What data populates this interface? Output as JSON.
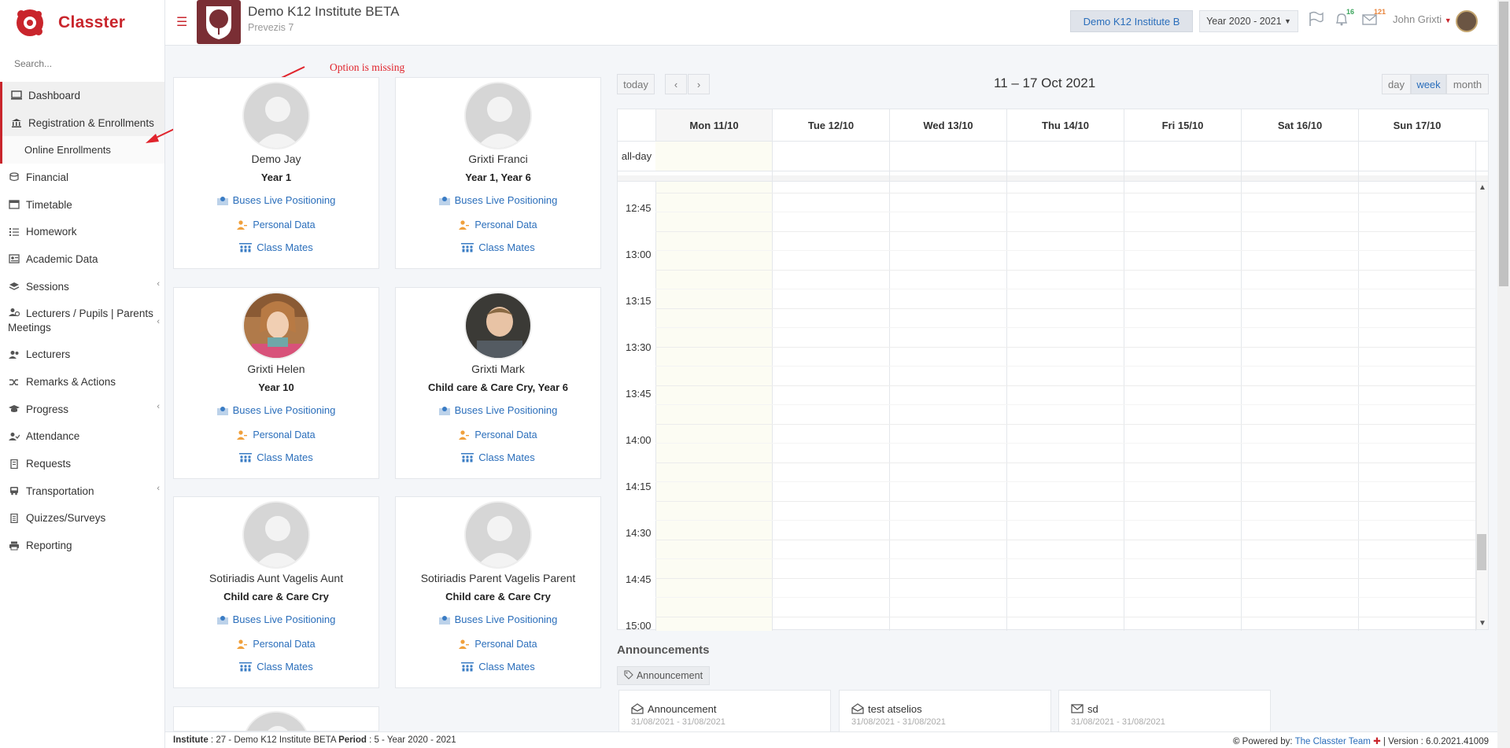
{
  "app": {
    "brand": "Classter"
  },
  "search": {
    "placeholder": "Search..."
  },
  "sidebar": {
    "items": [
      {
        "label": "Dashboard",
        "icon": "monitor-icon"
      },
      {
        "label": "Registration & Enrollments",
        "icon": "institution-icon"
      },
      {
        "label": "Online Enrollments",
        "icon": ""
      },
      {
        "label": "Financial",
        "icon": "coins-icon"
      },
      {
        "label": "Timetable",
        "icon": "calendar-icon"
      },
      {
        "label": "Homework",
        "icon": "list-icon"
      },
      {
        "label": "Academic Data",
        "icon": "id-card-icon"
      },
      {
        "label": "Sessions",
        "icon": "layers-icon"
      },
      {
        "label": "Lecturers / Pupils | Parents Meetings",
        "icon": "users-clock-icon"
      },
      {
        "label": "Lecturers",
        "icon": "users-icon"
      },
      {
        "label": "Remarks & Actions",
        "icon": "shuffle-icon"
      },
      {
        "label": "Progress",
        "icon": "graduation-cap-icon"
      },
      {
        "label": "Attendance",
        "icon": "user-check-icon"
      },
      {
        "label": "Requests",
        "icon": "document-icon"
      },
      {
        "label": "Transportation",
        "icon": "bus-icon"
      },
      {
        "label": "Quizzes/Surveys",
        "icon": "checklist-icon"
      },
      {
        "label": "Reporting",
        "icon": "printer-icon"
      }
    ]
  },
  "header": {
    "institute_name": "Demo K12 Institute BETA",
    "institute_sub": "Prevezis 7",
    "institute_button": "Demo K12 Institute B",
    "year_select": "Year 2020 - 2021",
    "notifications_count": "16",
    "messages_count": "121",
    "user_name": "John Grixti"
  },
  "annotation": {
    "text": "Option is missing"
  },
  "cards": [
    {
      "name": "Demo Jay",
      "year": "Year 1",
      "buses": "Buses Live Positioning",
      "personal": "Personal Data",
      "mates": "Class Mates",
      "photo": "placeholder"
    },
    {
      "name": "Grixti Franci",
      "year": "Year 1, Year 6",
      "buses": "Buses Live Positioning",
      "personal": "Personal Data",
      "mates": "Class Mates",
      "photo": "placeholder"
    },
    {
      "name": "Grixti Helen",
      "year": "Year 10",
      "buses": "Buses Live Positioning",
      "personal": "Personal Data",
      "mates": "Class Mates",
      "photo": "woman"
    },
    {
      "name": "Grixti Mark",
      "year": "Child care & Care Cry, Year 6",
      "buses": "Buses Live Positioning",
      "personal": "Personal Data",
      "mates": "Class Mates",
      "photo": "boy"
    },
    {
      "name": "Sotiriadis Aunt Vagelis Aunt",
      "year": "Child care & Care Cry",
      "buses": "Buses Live Positioning",
      "personal": "Personal Data",
      "mates": "Class Mates",
      "photo": "placeholder"
    },
    {
      "name": "Sotiriadis Parent Vagelis Parent",
      "year": "Child care & Care Cry",
      "buses": "Buses Live Positioning",
      "personal": "Personal Data",
      "mates": "Class Mates",
      "photo": "placeholder"
    }
  ],
  "calendar": {
    "today_label": "today",
    "prev_label": "‹",
    "next_label": "›",
    "title": "11 – 17 Oct 2021",
    "views": [
      "day",
      "week",
      "month"
    ],
    "active_view": "week",
    "allday_label": "all-day",
    "days": [
      "Mon 11/10",
      "Tue 12/10",
      "Wed 13/10",
      "Thu 14/10",
      "Fri 15/10",
      "Sat 16/10",
      "Sun 17/10"
    ],
    "times": [
      "12:45",
      "13:00",
      "13:15",
      "13:30",
      "13:45",
      "14:00",
      "14:15",
      "14:30",
      "14:45",
      "15:00"
    ]
  },
  "announcements": {
    "title": "Announcements",
    "tag": "Announcement",
    "items": [
      {
        "title": "Announcement",
        "date": "31/08/2021 - 31/08/2021",
        "icon": "envelope-open-icon"
      },
      {
        "title": "test atselios",
        "date": "31/08/2021 - 31/08/2021",
        "icon": "envelope-open-icon"
      },
      {
        "title": "sd",
        "date": "31/08/2021 - 31/08/2021",
        "icon": "envelope-icon"
      }
    ]
  },
  "footer": {
    "institute_label": "Institute",
    "institute_value": " : 27 - Demo K12 Institute BETA ",
    "period_label": "Period",
    "period_value": " : 5 - Year 2020 - 2021",
    "powered_label": "Powered by: ",
    "powered_link": "The Classter Team",
    "version": " | Version : 6.0.2021.41009"
  },
  "colors": {
    "brand": "#c9252c",
    "link": "#2a6ebb",
    "annotation": "#e0242c"
  }
}
